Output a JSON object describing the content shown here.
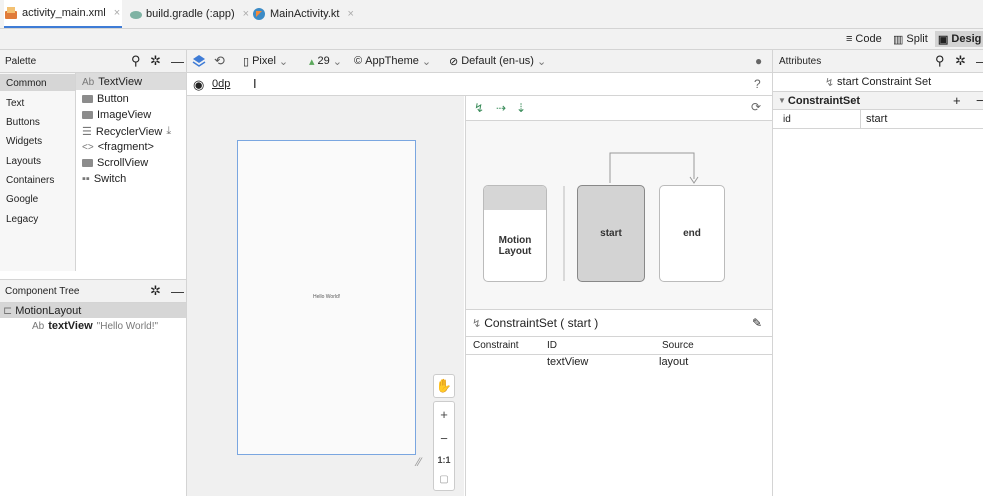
{
  "tabs": [
    {
      "label": "activity_main.xml",
      "active": true
    },
    {
      "label": "build.gradle (:app)",
      "active": false
    },
    {
      "label": "MainActivity.kt",
      "active": false
    }
  ],
  "modes": {
    "code": "Code",
    "split": "Split",
    "design": "Desig"
  },
  "palette": {
    "title": "Palette",
    "categories": [
      "Common",
      "Text",
      "Buttons",
      "Widgets",
      "Layouts",
      "Containers",
      "Google",
      "Legacy"
    ],
    "widgets": [
      {
        "prefix": "Ab",
        "label": "TextView"
      },
      {
        "label": "Button"
      },
      {
        "label": "ImageView"
      },
      {
        "label": "RecyclerView"
      },
      {
        "prefix": "<>",
        "label": "<fragment>"
      },
      {
        "label": "ScrollView"
      },
      {
        "label": "Switch"
      }
    ]
  },
  "toolbar": {
    "device": "Pixel",
    "api": "29",
    "theme": "AppTheme",
    "locale": "Default (en-us)",
    "margin": "0dp"
  },
  "component_tree": {
    "title": "Component Tree",
    "root": "MotionLayout",
    "child_prefix": "Ab",
    "child_id": "textView",
    "child_text": "\"Hello World!\""
  },
  "canvas": {
    "preview_text": "Hello World!",
    "zoom_ratio": "1:1"
  },
  "motion": {
    "cards": {
      "motion_layout": "Motion Layout",
      "start": "start",
      "end": "end"
    },
    "constraint_header": "ConstraintSet ( start )",
    "columns": [
      "Constraint",
      "ID",
      "Source"
    ],
    "rows": [
      {
        "constraint": "",
        "id": "textView",
        "source": "layout"
      }
    ]
  },
  "attributes": {
    "title": "Attributes",
    "subtitle": "start Constraint Set",
    "section": "ConstraintSet",
    "rows": [
      {
        "key": "id",
        "value": "start"
      }
    ]
  },
  "colors": {
    "accent": "#3f7cd6",
    "panel_bg": "#f2f2f2",
    "border": "#d4d4d4"
  }
}
